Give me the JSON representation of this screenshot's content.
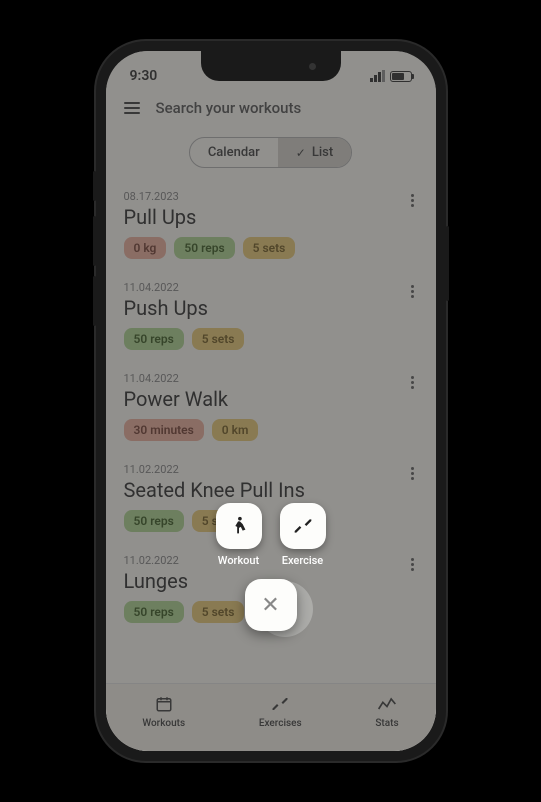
{
  "status": {
    "time": "9:30"
  },
  "search": {
    "placeholder": "Search your workouts"
  },
  "toggle": {
    "calendar": "Calendar",
    "list": "List"
  },
  "workouts": [
    {
      "date": "08.17.2023",
      "title": "Pull Ups",
      "chips": [
        {
          "text": "0 kg",
          "cls": "red"
        },
        {
          "text": "50 reps",
          "cls": "green"
        },
        {
          "text": "5 sets",
          "cls": "yellow"
        }
      ]
    },
    {
      "date": "11.04.2022",
      "title": "Push Ups",
      "chips": [
        {
          "text": "50 reps",
          "cls": "green"
        },
        {
          "text": "5 sets",
          "cls": "yellow"
        }
      ]
    },
    {
      "date": "11.04.2022",
      "title": "Power Walk",
      "chips": [
        {
          "text": "30 minutes",
          "cls": "red"
        },
        {
          "text": "0 km",
          "cls": "yellow"
        }
      ]
    },
    {
      "date": "11.02.2022",
      "title": "Seated Knee Pull Ins",
      "chips": [
        {
          "text": "50 reps",
          "cls": "green"
        },
        {
          "text": "5 sets",
          "cls": "yellow"
        }
      ]
    },
    {
      "date": "11.02.2022",
      "title": "Lunges",
      "chips": [
        {
          "text": "50 reps",
          "cls": "green"
        },
        {
          "text": "5 sets",
          "cls": "yellow"
        }
      ]
    }
  ],
  "fab": {
    "workout": "Workout",
    "exercise": "Exercise"
  },
  "nav": {
    "workouts": "Workouts",
    "exercises": "Exercises",
    "stats": "Stats"
  }
}
